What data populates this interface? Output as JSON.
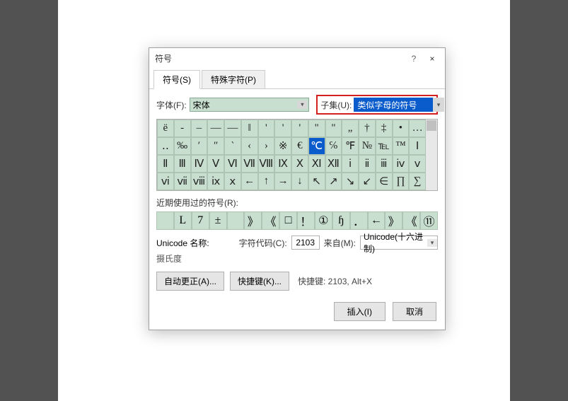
{
  "dialog": {
    "title": "符号",
    "help": "?",
    "close": "×",
    "tabs": {
      "symbols": "符号(S)",
      "special": "特殊字符(P)"
    },
    "font_label": "字体(F):",
    "font_value": "宋体",
    "subset_label": "子集(U):",
    "subset_value": "类似字母的符号",
    "grid": [
      "ё",
      "-",
      "‒",
      "―",
      "―",
      "‖",
      "'",
      "'",
      "'",
      "\"",
      "\"",
      "„",
      "†",
      "‡",
      "•",
      "…",
      "‥",
      "‰",
      "′",
      "″",
      "‵",
      "‹",
      "›",
      "※",
      "€",
      "℃",
      "℅",
      "℉",
      "№",
      "℡",
      "™",
      "Ⅰ",
      "Ⅱ",
      "Ⅲ",
      "Ⅳ",
      "Ⅴ",
      "Ⅵ",
      "Ⅶ",
      "Ⅷ",
      "Ⅸ",
      "Ⅹ",
      "Ⅺ",
      "Ⅻ",
      "ⅰ",
      "ⅱ",
      "ⅲ",
      "ⅳ",
      "ⅴ",
      "ⅵ",
      "ⅶ",
      "ⅷ",
      "ⅸ",
      "ⅹ",
      "←",
      "↑",
      "→",
      "↓",
      "↖",
      "↗",
      "↘",
      "↙",
      "∈",
      "∏",
      "∑"
    ],
    "selected_index": 25,
    "recent_label": "近期使用过的符号(R):",
    "recent": [
      "　",
      "L",
      "7",
      "±",
      "　",
      "》",
      "《",
      "□",
      "！",
      "①",
      "ɧ",
      "．",
      "←",
      "》",
      "《",
      "⑪"
    ],
    "unicode_name_label": "Unicode 名称:",
    "unicode_name_value": "摄氏度",
    "code_label": "字符代码(C):",
    "code_value": "2103",
    "from_label": "来自(M):",
    "from_value": "Unicode(十六进制)",
    "autocorrect_btn": "自动更正(A)...",
    "shortcut_btn": "快捷键(K)...",
    "shortcut_text": "快捷键: 2103, Alt+X",
    "insert_btn": "插入(I)",
    "cancel_btn": "取消"
  }
}
